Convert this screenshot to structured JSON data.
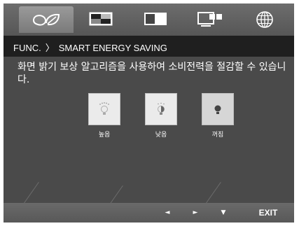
{
  "tabs": [
    {
      "icon": "eco-leaf-icon",
      "active": true
    },
    {
      "icon": "picture-icon",
      "active": false
    },
    {
      "icon": "split-screen-icon",
      "active": false
    },
    {
      "icon": "pip-icon",
      "active": false
    },
    {
      "icon": "globe-icon",
      "active": false
    }
  ],
  "header": {
    "func_label": "FUNC.",
    "separator": "〉",
    "title": "SMART ENERGY SAVING"
  },
  "description": "화면 밝기 보상 알고리즘을 사용하여 소비전력을 절감할 수 있습니다.",
  "options": [
    {
      "label": "높음",
      "icon": "bulb-high-icon",
      "selected": false
    },
    {
      "label": "낮음",
      "icon": "bulb-low-icon",
      "selected": false
    },
    {
      "label": "꺼짐",
      "icon": "bulb-off-icon",
      "selected": true
    }
  ],
  "footer": {
    "left_arrow": "◄",
    "right_arrow": "►",
    "down_arrow": "▼",
    "exit_label": "EXIT"
  },
  "colors": {
    "frame_bg": "#4a4a4a",
    "header_bg": "#1f1f1f",
    "text": "#ffffff",
    "option_bg": "#ebebeb",
    "option_selected_bg": "#d6d6d6"
  }
}
